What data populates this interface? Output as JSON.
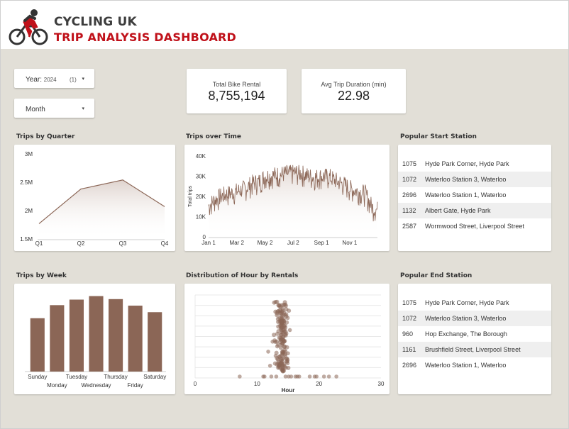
{
  "header": {
    "title": "CYCLING UK",
    "subtitle": "TRIP ANALYSIS DASHBOARD",
    "logo_icon": "cyclist-icon"
  },
  "filters": {
    "year_label": "Year:",
    "year_value": "2024",
    "year_count": "(1)",
    "month_label": "Month",
    "caret": "▾"
  },
  "kpis": {
    "total_label": "Total Bike Rental",
    "total_value": "8,755,194",
    "avg_label": "Avg Trip Duration (min)",
    "avg_value": "22.98"
  },
  "sections": {
    "quarter": "Trips by Quarter",
    "time": "Trips over Time",
    "start_station": "Popular Start Station",
    "week": "Trips by Week",
    "hour": "Distribution of Hour by Rentals",
    "end_station": "Popular End Station"
  },
  "start_stations": [
    {
      "count": "1075",
      "name": "Hyde Park Corner, Hyde Park"
    },
    {
      "count": "1072",
      "name": "Waterloo Station 3, Waterloo"
    },
    {
      "count": "2696",
      "name": "Waterloo Station 1, Waterloo"
    },
    {
      "count": "1132",
      "name": "Albert Gate, Hyde Park"
    },
    {
      "count": "2587",
      "name": "Wormwood Street, Liverpool Street"
    }
  ],
  "end_stations": [
    {
      "count": "1075",
      "name": "Hyde Park Corner, Hyde Park"
    },
    {
      "count": "1072",
      "name": "Waterloo Station 3, Waterloo"
    },
    {
      "count": "960",
      "name": "Hop Exchange, The Borough"
    },
    {
      "count": "1161",
      "name": "Brushfield Street, Liverpool Street"
    },
    {
      "count": "2696",
      "name": "Waterloo Station 1, Waterloo"
    }
  ],
  "colors": {
    "accent": "#c0111a",
    "series": "#8b6656",
    "bar": "#8b6656",
    "canvas": "#e2dfd7"
  },
  "chart_data": [
    {
      "id": "quarter",
      "type": "area",
      "categories": [
        "Q1",
        "Q2",
        "Q3",
        "Q4"
      ],
      "values": [
        1770000,
        2380000,
        2540000,
        2070000
      ],
      "yticks": [
        1500000,
        2000000,
        2500000,
        3000000
      ],
      "ytick_labels": [
        "1.5M",
        "2M",
        "2.5M",
        "3M"
      ],
      "ylim": [
        1500000,
        3000000
      ],
      "title": "Trips by Quarter"
    },
    {
      "id": "time",
      "type": "area",
      "title": "Trips over Time",
      "ylabel": "Total trips",
      "xlim": [
        "2024-01-01",
        "2024-12-31"
      ],
      "xtick_labels": [
        "Jan 1",
        "Mar 2",
        "May 2",
        "Jul 2",
        "Sep 1",
        "Nov 1"
      ],
      "xtick_dates": [
        "2024-01-01",
        "2024-03-02",
        "2024-05-02",
        "2024-07-02",
        "2024-09-01",
        "2024-11-01"
      ],
      "yticks": [
        0,
        10000,
        20000,
        30000,
        40000
      ],
      "ytick_labels": [
        "0",
        "10K",
        "20K",
        "30K",
        "40K"
      ],
      "ylim": [
        0,
        40000
      ],
      "anchors": [
        [
          "2024-01-01",
          14000
        ],
        [
          "2024-01-15",
          17000
        ],
        [
          "2024-02-01",
          19000
        ],
        [
          "2024-02-15",
          20000
        ],
        [
          "2024-03-02",
          21000
        ],
        [
          "2024-03-20",
          22500
        ],
        [
          "2024-04-05",
          25000
        ],
        [
          "2024-04-20",
          26000
        ],
        [
          "2024-05-02",
          28500
        ],
        [
          "2024-05-20",
          29000
        ],
        [
          "2024-06-05",
          29500
        ],
        [
          "2024-06-20",
          30000
        ],
        [
          "2024-07-02",
          30500
        ],
        [
          "2024-07-20",
          30000
        ],
        [
          "2024-08-05",
          28500
        ],
        [
          "2024-08-20",
          28000
        ],
        [
          "2024-09-01",
          28500
        ],
        [
          "2024-09-20",
          28000
        ],
        [
          "2024-10-05",
          26000
        ],
        [
          "2024-10-20",
          24500
        ],
        [
          "2024-11-01",
          22500
        ],
        [
          "2024-11-20",
          21000
        ],
        [
          "2024-12-05",
          20000
        ],
        [
          "2024-12-20",
          13000
        ],
        [
          "2024-12-31",
          12000
        ]
      ]
    },
    {
      "id": "week",
      "type": "bar",
      "title": "Trips by Week",
      "categories": [
        "Sunday",
        "Monday",
        "Tuesday",
        "Wednesday",
        "Thursday",
        "Friday",
        "Saturday"
      ],
      "values": [
        1060000,
        1320000,
        1430000,
        1500000,
        1440000,
        1310000,
        1180000
      ],
      "ylim": [
        0,
        1550000
      ]
    },
    {
      "id": "hour",
      "type": "scatter",
      "title": "Distribution of Hour by Rentals",
      "xlabel": "Hour",
      "xlim": [
        0,
        30
      ],
      "xticks": [
        0,
        10,
        20,
        30
      ],
      "ylim": [
        0,
        1
      ],
      "cluster": {
        "x_center": 14,
        "x_spread": 0.7,
        "y_from": 0.08,
        "y_to": 0.92,
        "count": 160
      },
      "outliers": [
        [
          7.2,
          0.0
        ],
        [
          11.0,
          0.0
        ],
        [
          11.2,
          0.0
        ],
        [
          12.3,
          0.0
        ],
        [
          13.1,
          0.0
        ],
        [
          14.6,
          0.0
        ],
        [
          15.1,
          0.0
        ],
        [
          15.5,
          0.0
        ],
        [
          16.2,
          0.0
        ],
        [
          16.5,
          0.0
        ],
        [
          16.8,
          0.0
        ],
        [
          18.5,
          0.0
        ],
        [
          19.3,
          0.0
        ],
        [
          19.6,
          0.0
        ],
        [
          20.8,
          0.0
        ],
        [
          21.6,
          0.0
        ],
        [
          22.8,
          0.0
        ],
        [
          12.1,
          0.13
        ],
        [
          11.8,
          0.3
        ],
        [
          12.5,
          0.42
        ],
        [
          15.3,
          0.56
        ],
        [
          13.0,
          0.25
        ],
        [
          15.0,
          0.28
        ]
      ]
    }
  ]
}
